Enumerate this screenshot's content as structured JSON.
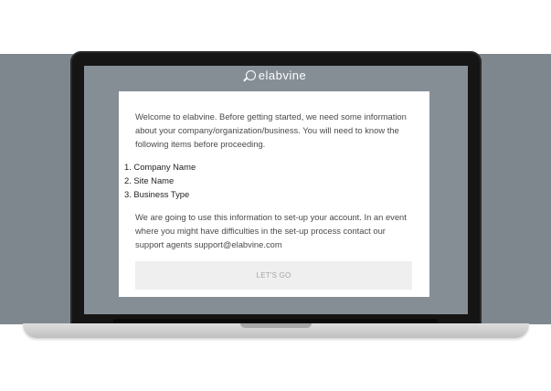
{
  "brand": {
    "logo_text": "elabvine",
    "logo_icon": "magnifier-leaf-icon"
  },
  "card": {
    "intro": "Welcome to elabvine. Before getting started, we need some information about your company/organization/business. You will need to know the following items before proceeding.",
    "items": [
      "1. Company Name",
      "2. Site Name",
      "3. Business Type"
    ],
    "outro": "We are going to use this information to set-up your account. In an event where you might have difficulties in the set-up process contact our support agents support@elabvine.com",
    "cta_label": "LET'S GO"
  },
  "colors": {
    "band": "#7f878e",
    "screen": "#868e95",
    "card": "#ffffff",
    "button_bg": "#efefef",
    "button_text": "#a4a4a4"
  }
}
